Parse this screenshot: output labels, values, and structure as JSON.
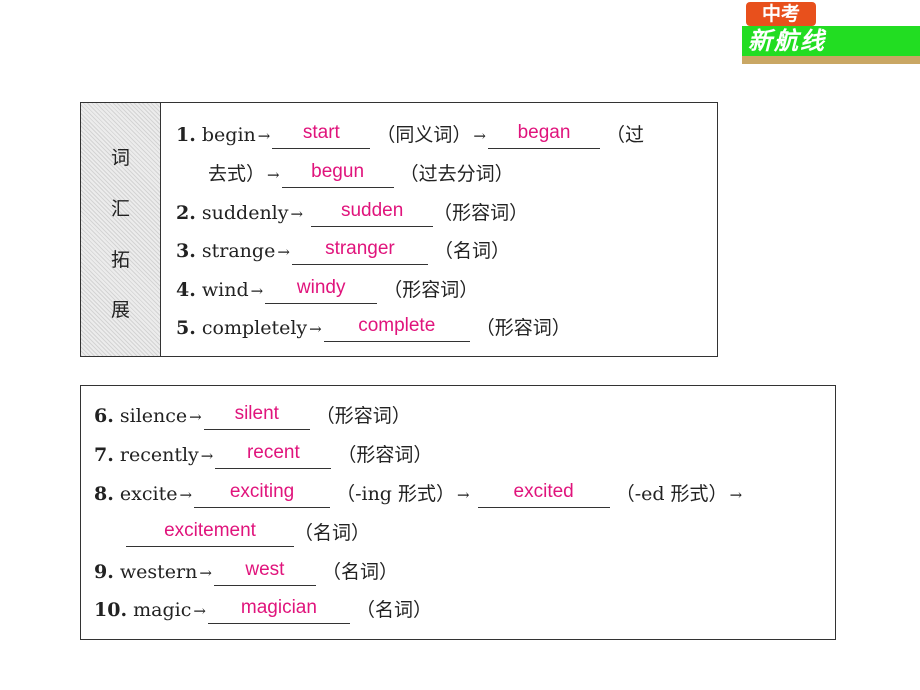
{
  "logo": {
    "top": "中考",
    "main": "新航线"
  },
  "section1": {
    "side_label": [
      "词",
      "汇",
      "拓",
      "展"
    ],
    "items": [
      {
        "num": "1.",
        "word": "begin",
        "a1": "start",
        "n1": "（同义词）",
        "a2": "began",
        "n2": "（过",
        "cont": "去式）",
        "a3": "begun",
        "n3": "（过去分词）"
      },
      {
        "num": "2.",
        "word": "suddenly",
        "answer": "sudden",
        "note": "（形容词）"
      },
      {
        "num": "3.",
        "word": "strange",
        "answer": "stranger",
        "note": "（名词）"
      },
      {
        "num": "4.",
        "word": "wind",
        "answer": "windy",
        "note": "（形容词）"
      },
      {
        "num": "5.",
        "word": "completely",
        "answer": "complete",
        "note": "（形容词）"
      }
    ]
  },
  "section2": {
    "items": [
      {
        "num": "6.",
        "word": "silence",
        "answer": "silent",
        "note": "（形容词）"
      },
      {
        "num": "7.",
        "word": "recently",
        "answer": "recent",
        "note": "（形容词）"
      },
      {
        "num": "8.",
        "word": "excite",
        "a1": "exciting",
        "n1": "（-ing 形式）",
        "a2": "excited",
        "n2": "（-ed 形式）",
        "a3": "excitement",
        "n3": "（名词）"
      },
      {
        "num": "9.",
        "word": "western",
        "answer": "west",
        "note": "（名词）"
      },
      {
        "num": "10.",
        "word": "magic",
        "answer": "magician",
        "note": "（名词）"
      }
    ]
  },
  "arrow": "→"
}
